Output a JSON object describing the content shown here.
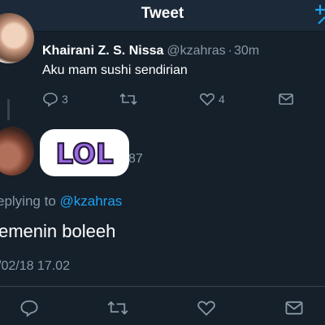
{
  "header": {
    "title": "Tweet",
    "compose_icon": "compose-icon"
  },
  "parent_tweet": {
    "author_name": "Khairani Z. S. Nissa",
    "handle": "@kzahras",
    "separator": "·",
    "time": "30m",
    "text": "Aku mam sushi sendirian",
    "actions": {
      "reply_count": "3",
      "retweet_count": "",
      "like_count": "4"
    }
  },
  "reply_tweet": {
    "sticker_text": "LOL",
    "partial_count": "87",
    "replying_prefix": "eplying to ",
    "replying_handle": "@kzahras",
    "text": "emenin boleeh",
    "timestamp": "/02/18 17.02"
  },
  "colors": {
    "background": "#15202b",
    "header": "#1c2938",
    "secondary_text": "#8899a6",
    "link": "#1da1f2",
    "sticker_purple": "#9c6be0"
  }
}
